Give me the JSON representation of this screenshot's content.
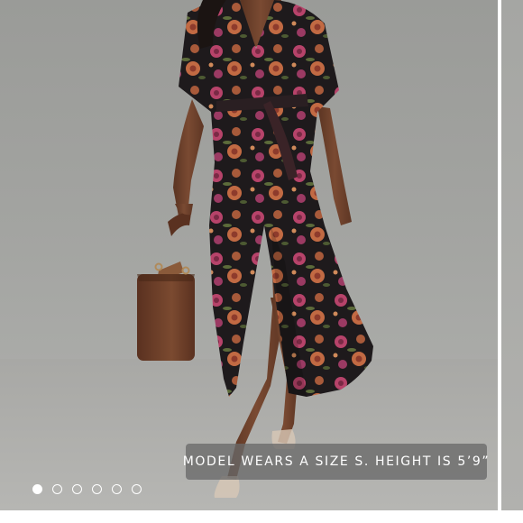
{
  "product_gallery": {
    "caption": "MODEL WEARS A SIZE S. HEIGHT IS 5’9”",
    "slide_count": 6,
    "active_slide": 1,
    "colors": {
      "backdrop": "#a3a4a1",
      "dress_base": "#1e1a1c",
      "floral_pink": "#b7436a",
      "floral_rust": "#a85a3a",
      "handbag": "#6a3f2a"
    }
  }
}
